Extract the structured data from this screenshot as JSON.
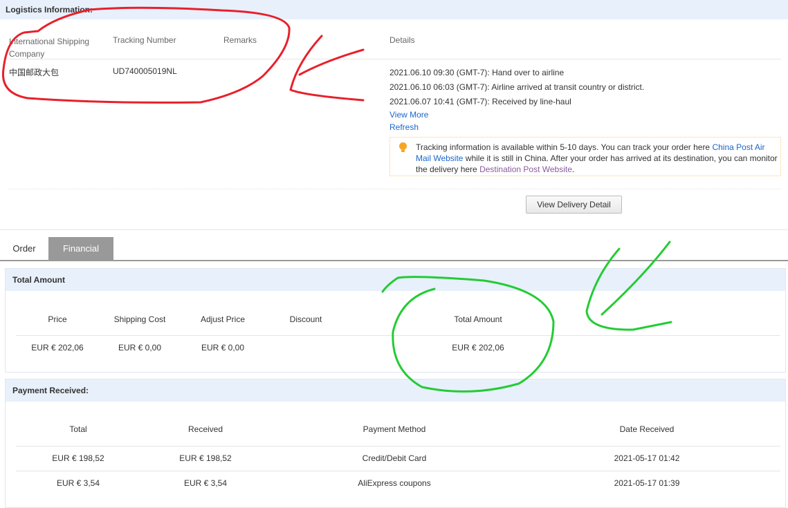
{
  "logistics": {
    "title": "Logistics Information:",
    "headers": {
      "company": "International Shipping Company",
      "tracking": "Tracking Number",
      "remarks": "Remarks",
      "details": "Details"
    },
    "row": {
      "company": "中国邮政大包",
      "tracking": "UD740005019NL",
      "remarks": ""
    },
    "events": [
      "2021.06.10 09:30 (GMT-7): Hand over to airline",
      "2021.06.10 06:03 (GMT-7): Airline arrived at transit country or district.",
      "2021.06.07 10:41 (GMT-7): Received by line-haul"
    ],
    "view_more": "View More",
    "refresh": "Refresh",
    "notice": {
      "t1": "Tracking information is available within 5-10 days. You can track your order here ",
      "link1": "China Post Air Mail Website",
      "t2": " while it is still in China. After your order has arrived at its destination, you can monitor the delivery here ",
      "link2": "Destination Post Website",
      "t3": "."
    },
    "view_delivery_button": "View Delivery Detail"
  },
  "tabs": [
    {
      "label": "Order",
      "active": false
    },
    {
      "label": "Financial",
      "active": true
    }
  ],
  "total_amount": {
    "title": "Total Amount",
    "headers": [
      "Price",
      "Shipping Cost",
      "Adjust Price",
      "Discount",
      "Total Amount"
    ],
    "values": [
      "EUR € 202,06",
      "EUR € 0,00",
      "EUR € 0,00",
      "",
      "EUR € 202,06"
    ]
  },
  "payment": {
    "title": "Payment Received:",
    "headers": [
      "Total",
      "Received",
      "Payment Method",
      "Date Received"
    ],
    "rows": [
      [
        "EUR € 198,52",
        "EUR € 198,52",
        "Credit/Debit Card",
        "2021-05-17 01:42"
      ],
      [
        "EUR € 3,54",
        "EUR € 3,54",
        "AliExpress coupons",
        "2021-05-17 01:39"
      ]
    ]
  },
  "colors": {
    "header_bg": "#e8f0fb",
    "link": "#1a66cc",
    "tab_active": "#999999",
    "annot_red": "#e8202a",
    "annot_green": "#22cc33"
  }
}
